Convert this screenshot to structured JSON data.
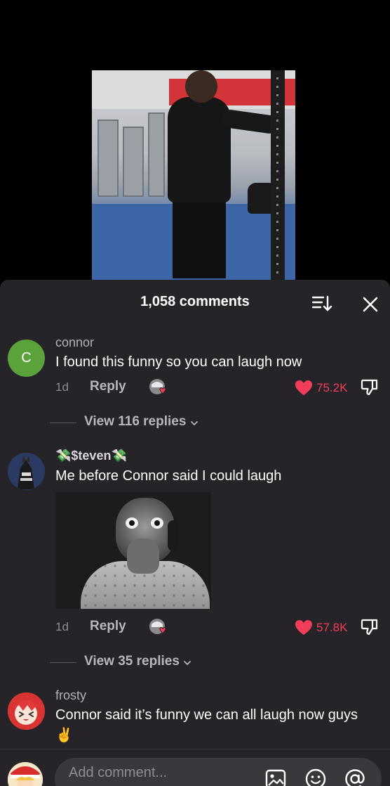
{
  "comments_header": {
    "count_label": "1,058 comments",
    "sort_icon": "sort-descending-icon",
    "close_icon": "close-icon"
  },
  "comments": [
    {
      "username": "connor",
      "avatar_letter": "C",
      "avatar_color": "#5ba23b",
      "text": "I found this funny so you can laugh now",
      "age": "1d",
      "reply_label": "Reply",
      "likes": "75.2K",
      "view_replies": "View 116 replies"
    },
    {
      "username": "💸$teven💸",
      "text": "Me before Connor said I could laugh",
      "age": "1d",
      "reply_label": "Reply",
      "likes": "57.8K",
      "view_replies": "View 35 replies"
    },
    {
      "username": "frosty",
      "text": "Connor said it’s funny we can all laugh now guys ✌️"
    }
  ],
  "input": {
    "placeholder": "Add comment..."
  },
  "colors": {
    "sheet_bg": "#262428",
    "like_red": "#f23d5a",
    "muted_text": "#b3b1b6"
  }
}
